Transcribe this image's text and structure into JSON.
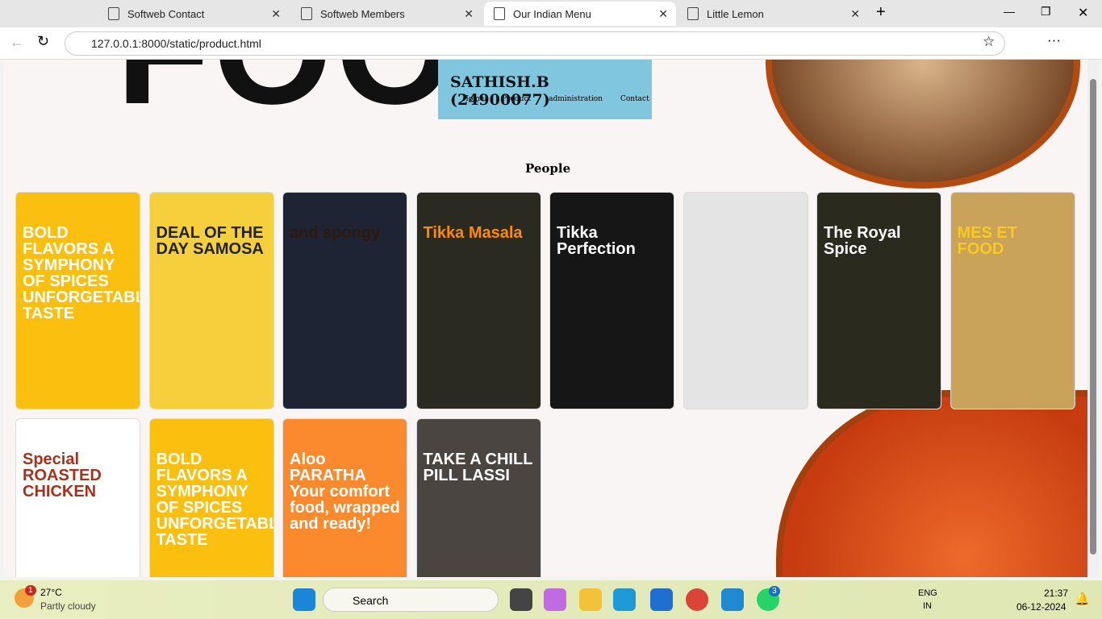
{
  "browser": {
    "tabs": [
      {
        "label": "Softweb Contact"
      },
      {
        "label": "Softweb Members"
      },
      {
        "label": "Our Indian Menu"
      },
      {
        "label": "Little Lemon"
      }
    ],
    "url": "127.0.0.1:8000/static/product.html"
  },
  "page": {
    "hero_text": "FOOD",
    "banner_title": "SATHISH.B (24900077)",
    "nav": [
      "Home",
      "Product",
      "administration",
      "Contact"
    ],
    "section_title": "People",
    "cards": [
      {
        "text": "BOLD FLAVORS A SYMPHONY OF SPICES UNFORGETABLE TASTE",
        "bg": "#fbbf10",
        "fg": "#fff"
      },
      {
        "text": "DEAL OF THE DAY SAMOSA",
        "bg": "#f5cf3c",
        "fg": "#222"
      },
      {
        "text": "and spongy",
        "bg": "#1e2433",
        "fg": "#2b1a10"
      },
      {
        "text": "Tikka Masala",
        "bg": "#2a2a20",
        "fg": "#ff8a00"
      },
      {
        "text": "Tikka Perfection",
        "bg": "#161616",
        "fg": "#fff"
      },
      {
        "text": "",
        "bg": "#e4e4e4",
        "fg": "#333"
      },
      {
        "text": "The Royal Spice",
        "bg": "#2b2a1e",
        "fg": "#fff"
      },
      {
        "text": "MES ET FOOD",
        "bg": "#c9a35a",
        "fg": "#f9c920"
      },
      {
        "text": "Special ROASTED CHICKEN",
        "bg": "#fff",
        "fg": "#a5331b"
      },
      {
        "text": "BOLD FLAVORS A SYMPHONY OF SPICES UNFORGETABLE TASTE",
        "bg": "#fbbf10",
        "fg": "#fff"
      },
      {
        "text": "Aloo PARATHA Your comfort food, wrapped and ready!",
        "bg": "#fb8a2f",
        "fg": "#fff"
      },
      {
        "text": "TAKE A CHILL PILL LASSI",
        "bg": "#4a4540",
        "fg": "#fff"
      }
    ]
  },
  "taskbar": {
    "weather_temp": "27°C",
    "weather_desc": "Partly cloudy",
    "weather_badge": "1",
    "search": "Search",
    "lang": "ENG",
    "region": "IN",
    "time": "21:37",
    "date": "06-12-2024",
    "whatsapp_badge": "3"
  }
}
